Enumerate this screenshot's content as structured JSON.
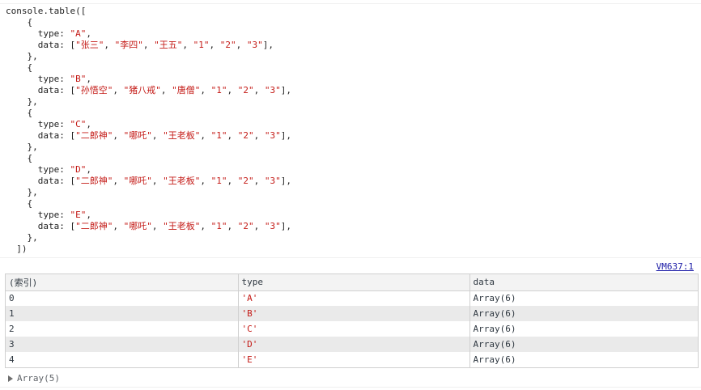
{
  "code": {
    "lines": [
      {
        "segments": [
          {
            "t": "console.table([",
            "s": 0
          }
        ]
      },
      {
        "segments": [
          {
            "t": "    {",
            "s": 0
          }
        ]
      },
      {
        "segments": [
          {
            "t": "      type: ",
            "s": 0
          },
          {
            "t": "\"A\"",
            "s": 1
          },
          {
            "t": ",",
            "s": 0
          }
        ]
      },
      {
        "segments": [
          {
            "t": "      data: [",
            "s": 0
          },
          {
            "t": "\"张三\"",
            "s": 1
          },
          {
            "t": ", ",
            "s": 0
          },
          {
            "t": "\"李四\"",
            "s": 1
          },
          {
            "t": ", ",
            "s": 0
          },
          {
            "t": "\"王五\"",
            "s": 1
          },
          {
            "t": ", ",
            "s": 0
          },
          {
            "t": "\"1\"",
            "s": 1
          },
          {
            "t": ", ",
            "s": 0
          },
          {
            "t": "\"2\"",
            "s": 1
          },
          {
            "t": ", ",
            "s": 0
          },
          {
            "t": "\"3\"",
            "s": 1
          },
          {
            "t": "],",
            "s": 0
          }
        ]
      },
      {
        "segments": [
          {
            "t": "    },",
            "s": 0
          }
        ]
      },
      {
        "segments": [
          {
            "t": "    {",
            "s": 0
          }
        ]
      },
      {
        "segments": [
          {
            "t": "      type: ",
            "s": 0
          },
          {
            "t": "\"B\"",
            "s": 1
          },
          {
            "t": ",",
            "s": 0
          }
        ]
      },
      {
        "segments": [
          {
            "t": "      data: [",
            "s": 0
          },
          {
            "t": "\"孙悟空\"",
            "s": 1
          },
          {
            "t": ", ",
            "s": 0
          },
          {
            "t": "\"猪八戒\"",
            "s": 1
          },
          {
            "t": ", ",
            "s": 0
          },
          {
            "t": "\"唐僧\"",
            "s": 1
          },
          {
            "t": ", ",
            "s": 0
          },
          {
            "t": "\"1\"",
            "s": 1
          },
          {
            "t": ", ",
            "s": 0
          },
          {
            "t": "\"2\"",
            "s": 1
          },
          {
            "t": ", ",
            "s": 0
          },
          {
            "t": "\"3\"",
            "s": 1
          },
          {
            "t": "],",
            "s": 0
          }
        ]
      },
      {
        "segments": [
          {
            "t": "    },",
            "s": 0
          }
        ]
      },
      {
        "segments": [
          {
            "t": "    {",
            "s": 0
          }
        ]
      },
      {
        "segments": [
          {
            "t": "      type: ",
            "s": 0
          },
          {
            "t": "\"C\"",
            "s": 1
          },
          {
            "t": ",",
            "s": 0
          }
        ]
      },
      {
        "segments": [
          {
            "t": "      data: [",
            "s": 0
          },
          {
            "t": "\"二郎神\"",
            "s": 1
          },
          {
            "t": ", ",
            "s": 0
          },
          {
            "t": "\"哪吒\"",
            "s": 1
          },
          {
            "t": ", ",
            "s": 0
          },
          {
            "t": "\"王老板\"",
            "s": 1
          },
          {
            "t": ", ",
            "s": 0
          },
          {
            "t": "\"1\"",
            "s": 1
          },
          {
            "t": ", ",
            "s": 0
          },
          {
            "t": "\"2\"",
            "s": 1
          },
          {
            "t": ", ",
            "s": 0
          },
          {
            "t": "\"3\"",
            "s": 1
          },
          {
            "t": "],",
            "s": 0
          }
        ]
      },
      {
        "segments": [
          {
            "t": "    },",
            "s": 0
          }
        ]
      },
      {
        "segments": [
          {
            "t": "    {",
            "s": 0
          }
        ]
      },
      {
        "segments": [
          {
            "t": "      type: ",
            "s": 0
          },
          {
            "t": "\"D\"",
            "s": 1
          },
          {
            "t": ",",
            "s": 0
          }
        ]
      },
      {
        "segments": [
          {
            "t": "      data: [",
            "s": 0
          },
          {
            "t": "\"二郎神\"",
            "s": 1
          },
          {
            "t": ", ",
            "s": 0
          },
          {
            "t": "\"哪吒\"",
            "s": 1
          },
          {
            "t": ", ",
            "s": 0
          },
          {
            "t": "\"王老板\"",
            "s": 1
          },
          {
            "t": ", ",
            "s": 0
          },
          {
            "t": "\"1\"",
            "s": 1
          },
          {
            "t": ", ",
            "s": 0
          },
          {
            "t": "\"2\"",
            "s": 1
          },
          {
            "t": ", ",
            "s": 0
          },
          {
            "t": "\"3\"",
            "s": 1
          },
          {
            "t": "],",
            "s": 0
          }
        ]
      },
      {
        "segments": [
          {
            "t": "    },",
            "s": 0
          }
        ]
      },
      {
        "segments": [
          {
            "t": "    {",
            "s": 0
          }
        ]
      },
      {
        "segments": [
          {
            "t": "      type: ",
            "s": 0
          },
          {
            "t": "\"E\"",
            "s": 1
          },
          {
            "t": ",",
            "s": 0
          }
        ]
      },
      {
        "segments": [
          {
            "t": "      data: [",
            "s": 0
          },
          {
            "t": "\"二郎神\"",
            "s": 1
          },
          {
            "t": ", ",
            "s": 0
          },
          {
            "t": "\"哪吒\"",
            "s": 1
          },
          {
            "t": ", ",
            "s": 0
          },
          {
            "t": "\"王老板\"",
            "s": 1
          },
          {
            "t": ", ",
            "s": 0
          },
          {
            "t": "\"1\"",
            "s": 1
          },
          {
            "t": ", ",
            "s": 0
          },
          {
            "t": "\"2\"",
            "s": 1
          },
          {
            "t": ", ",
            "s": 0
          },
          {
            "t": "\"3\"",
            "s": 1
          },
          {
            "t": "],",
            "s": 0
          }
        ]
      },
      {
        "segments": [
          {
            "t": "    },",
            "s": 0
          }
        ]
      },
      {
        "segments": [
          {
            "t": "  ])",
            "s": 0
          }
        ]
      }
    ]
  },
  "source_link": "VM637:1",
  "table": {
    "headers": [
      "(索引)",
      "type",
      "data"
    ],
    "rows": [
      [
        "0",
        "'A'",
        "Array(6)"
      ],
      [
        "1",
        "'B'",
        "Array(6)"
      ],
      [
        "2",
        "'C'",
        "Array(6)"
      ],
      [
        "3",
        "'D'",
        "Array(6)"
      ],
      [
        "4",
        "'E'",
        "Array(6)"
      ]
    ]
  },
  "summary": {
    "icon": "expand-triangle-icon",
    "label": "Array(5)"
  },
  "colors": {
    "string": "#c41a16",
    "link": "#1a1aa6",
    "stripe": "#eaeaea",
    "header_bg": "#f3f3f3",
    "border": "#d0d0d0"
  }
}
